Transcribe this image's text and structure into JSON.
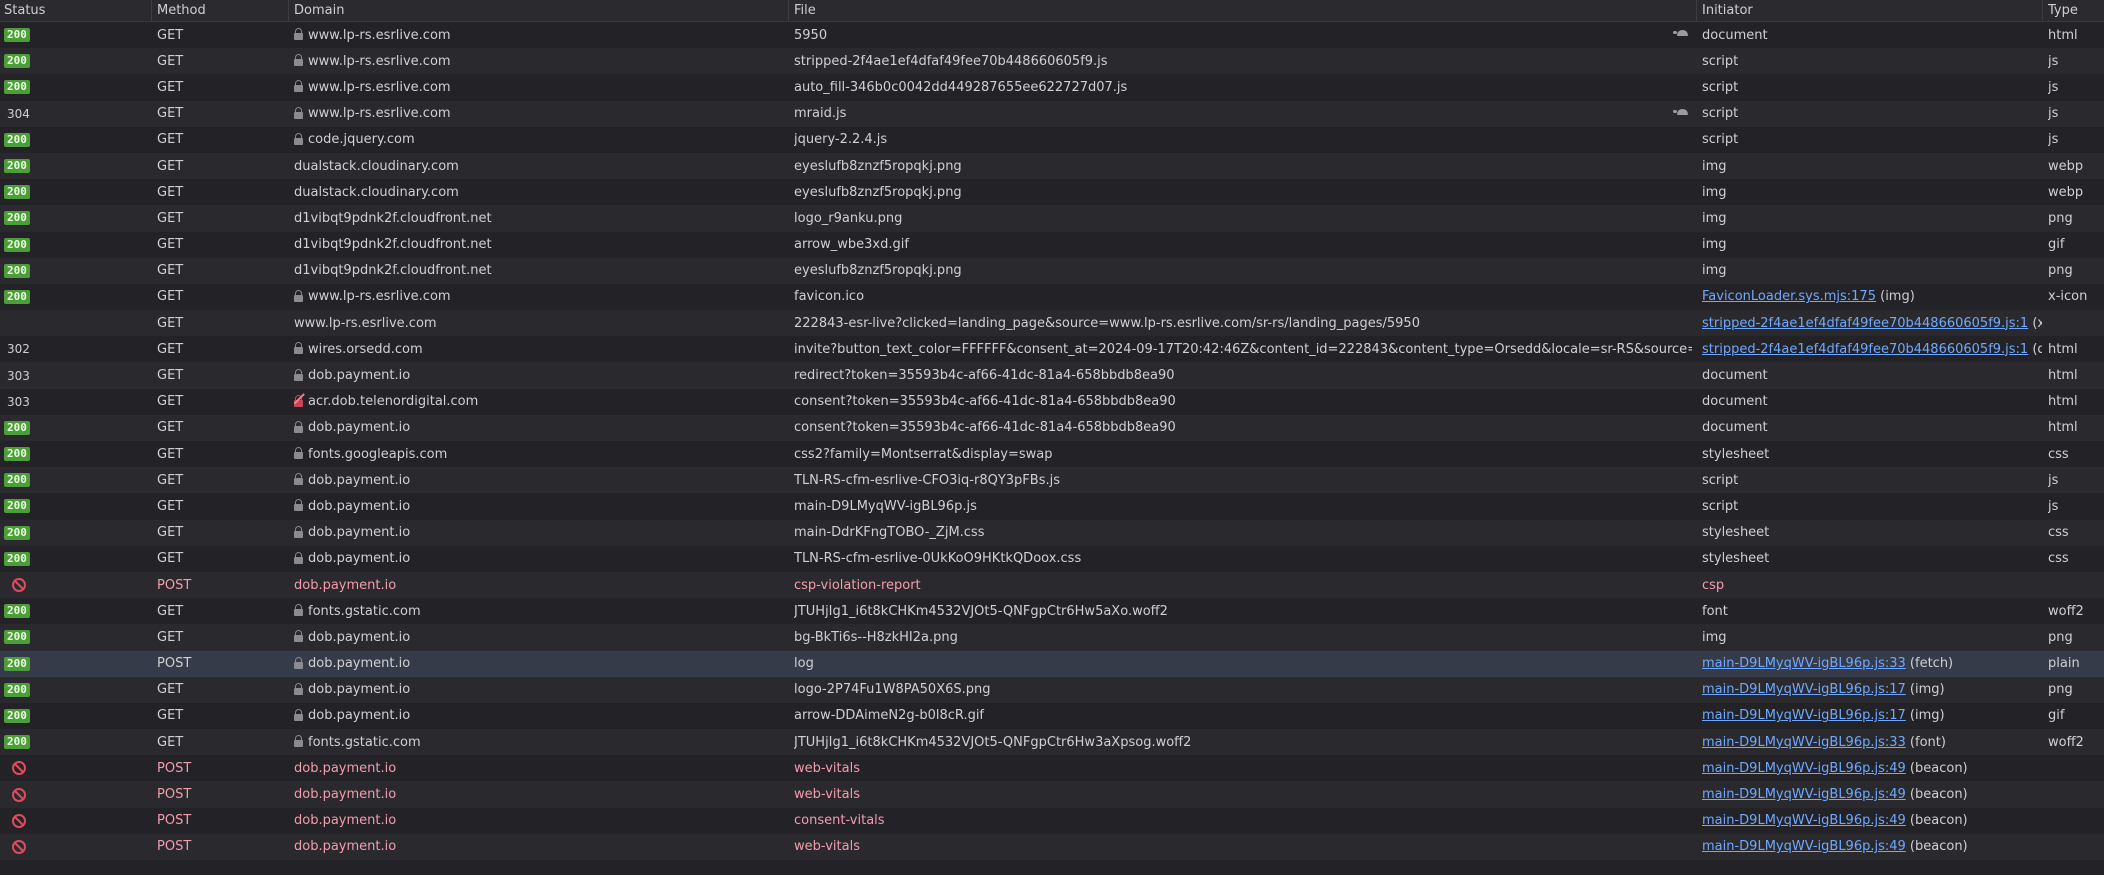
{
  "headers": {
    "status": "Status",
    "method": "Method",
    "domain": "Domain",
    "file": "File",
    "initiator": "Initiator",
    "type": "Type"
  },
  "rows": [
    {
      "status": "200",
      "method": "GET",
      "lock": "secure",
      "domain": "www.lp-rs.esrlive.com",
      "file": "5950",
      "initiator": "document",
      "initiator_link": false,
      "type": "html",
      "slow": true
    },
    {
      "status": "200",
      "method": "GET",
      "lock": "secure",
      "domain": "www.lp-rs.esrlive.com",
      "file": "stripped-2f4ae1ef4dfaf49fee70b448660605f9.js",
      "initiator": "script",
      "initiator_link": false,
      "type": "js"
    },
    {
      "status": "200",
      "method": "GET",
      "lock": "secure",
      "domain": "www.lp-rs.esrlive.com",
      "file": "auto_fill-346b0c0042dd449287655ee622727d07.js",
      "initiator": "script",
      "initiator_link": false,
      "type": "js"
    },
    {
      "status": "304",
      "method": "GET",
      "lock": "secure",
      "domain": "www.lp-rs.esrlive.com",
      "file": "mraid.js",
      "initiator": "script",
      "initiator_link": false,
      "type": "js",
      "slow": true
    },
    {
      "status": "200",
      "method": "GET",
      "lock": "secure",
      "domain": "code.jquery.com",
      "file": "jquery-2.2.4.js",
      "initiator": "script",
      "initiator_link": false,
      "type": "js"
    },
    {
      "status": "200",
      "method": "GET",
      "lock": "none",
      "domain": "dualstack.cloudinary.com",
      "file": "eyeslufb8znzf5ropqkj.png",
      "initiator": "img",
      "initiator_link": false,
      "type": "webp"
    },
    {
      "status": "200",
      "method": "GET",
      "lock": "none",
      "domain": "dualstack.cloudinary.com",
      "file": "eyeslufb8znzf5ropqkj.png",
      "initiator": "img",
      "initiator_link": false,
      "type": "webp"
    },
    {
      "status": "200",
      "method": "GET",
      "lock": "none",
      "domain": "d1vibqt9pdnk2f.cloudfront.net",
      "file": "logo_r9anku.png",
      "initiator": "img",
      "initiator_link": false,
      "type": "png"
    },
    {
      "status": "200",
      "method": "GET",
      "lock": "none",
      "domain": "d1vibqt9pdnk2f.cloudfront.net",
      "file": "arrow_wbe3xd.gif",
      "initiator": "img",
      "initiator_link": false,
      "type": "gif"
    },
    {
      "status": "200",
      "method": "GET",
      "lock": "none",
      "domain": "d1vibqt9pdnk2f.cloudfront.net",
      "file": "eyeslufb8znzf5ropqkj.png",
      "initiator": "img",
      "initiator_link": false,
      "type": "png"
    },
    {
      "status": "200",
      "method": "GET",
      "lock": "secure",
      "domain": "www.lp-rs.esrlive.com",
      "file": "favicon.ico",
      "initiator": "FaviconLoader.sys.mjs:175",
      "initiator_suffix": " (img)",
      "initiator_link": true,
      "type": "x-icon"
    },
    {
      "status": "",
      "method": "GET",
      "lock": "none",
      "domain": "www.lp-rs.esrlive.com",
      "file": "222843-esr-live?clicked=landing_page&source=www.lp-rs.esrlive.com/sr-rs/landing_pages/5950",
      "initiator": "stripped-2f4ae1ef4dfaf49fee70b448660605f9.js:1",
      "initiator_suffix": " (xhr)",
      "initiator_link": true,
      "type": ""
    },
    {
      "status": "302",
      "method": "GET",
      "lock": "secure",
      "domain": "wires.orsedd.com",
      "file": "invite?button_text_color=FFFFFF&consent_at=2024-09-17T20:42:46Z&content_id=222843&content_type=Orsedd&locale=sr-RS&source=www.lp-rs.esrlive.com/sr-rs",
      "initiator": "stripped-2f4ae1ef4dfaf49fee70b448660605f9.js:1",
      "initiator_suffix": " (docum...",
      "initiator_link": true,
      "type": "html"
    },
    {
      "status": "303",
      "method": "GET",
      "lock": "secure",
      "domain": "dob.payment.io",
      "file": "redirect?token=35593b4c-af66-41dc-81a4-658bbdb8ea90",
      "initiator": "document",
      "initiator_link": false,
      "type": "html"
    },
    {
      "status": "303",
      "method": "GET",
      "lock": "warn",
      "domain": "acr.dob.telenordigital.com",
      "file": "consent?token=35593b4c-af66-41dc-81a4-658bbdb8ea90",
      "initiator": "document",
      "initiator_link": false,
      "type": "html"
    },
    {
      "status": "200",
      "method": "GET",
      "lock": "secure",
      "domain": "dob.payment.io",
      "file": "consent?token=35593b4c-af66-41dc-81a4-658bbdb8ea90",
      "initiator": "document",
      "initiator_link": false,
      "type": "html"
    },
    {
      "status": "200",
      "method": "GET",
      "lock": "secure",
      "domain": "fonts.googleapis.com",
      "file": "css2?family=Montserrat&display=swap",
      "initiator": "stylesheet",
      "initiator_link": false,
      "type": "css"
    },
    {
      "status": "200",
      "method": "GET",
      "lock": "secure",
      "domain": "dob.payment.io",
      "file": "TLN-RS-cfm-esrlive-CFO3iq-r8QY3pFBs.js",
      "initiator": "script",
      "initiator_link": false,
      "type": "js"
    },
    {
      "status": "200",
      "method": "GET",
      "lock": "secure",
      "domain": "dob.payment.io",
      "file": "main-D9LMyqWV-igBL96p.js",
      "initiator": "script",
      "initiator_link": false,
      "type": "js"
    },
    {
      "status": "200",
      "method": "GET",
      "lock": "secure",
      "domain": "dob.payment.io",
      "file": "main-DdrKFngTOBO-_ZjM.css",
      "initiator": "stylesheet",
      "initiator_link": false,
      "type": "css"
    },
    {
      "status": "200",
      "method": "GET",
      "lock": "secure",
      "domain": "dob.payment.io",
      "file": "TLN-RS-cfm-esrlive-0UkKoO9HKtkQDoox.css",
      "initiator": "stylesheet",
      "initiator_link": false,
      "type": "css"
    },
    {
      "status": "blocked",
      "method": "POST",
      "lock": "none",
      "domain": "dob.payment.io",
      "file": "csp-violation-report",
      "initiator": "csp",
      "initiator_link": false,
      "type": ""
    },
    {
      "status": "200",
      "method": "GET",
      "lock": "secure",
      "domain": "fonts.gstatic.com",
      "file": "JTUHjIg1_i6t8kCHKm4532VJOt5-QNFgpCtr6Hw5aXo.woff2",
      "initiator": "font",
      "initiator_link": false,
      "type": "woff2"
    },
    {
      "status": "200",
      "method": "GET",
      "lock": "secure",
      "domain": "dob.payment.io",
      "file": "bg-BkTi6s--H8zkHI2a.png",
      "initiator": "img",
      "initiator_link": false,
      "type": "png"
    },
    {
      "status": "200",
      "method": "POST",
      "lock": "secure",
      "domain": "dob.payment.io",
      "file": "log",
      "initiator": "main-D9LMyqWV-igBL96p.js:33",
      "initiator_suffix": " (fetch)",
      "initiator_link": true,
      "type": "plain",
      "highlight": true
    },
    {
      "status": "200",
      "method": "GET",
      "lock": "secure",
      "domain": "dob.payment.io",
      "file": "logo-2P74Fu1W8PA50X6S.png",
      "initiator": "main-D9LMyqWV-igBL96p.js:17",
      "initiator_suffix": " (img)",
      "initiator_link": true,
      "type": "png"
    },
    {
      "status": "200",
      "method": "GET",
      "lock": "secure",
      "domain": "dob.payment.io",
      "file": "arrow-DDAimeN2g-b0l8cR.gif",
      "initiator": "main-D9LMyqWV-igBL96p.js:17",
      "initiator_suffix": " (img)",
      "initiator_link": true,
      "type": "gif"
    },
    {
      "status": "200",
      "method": "GET",
      "lock": "secure",
      "domain": "fonts.gstatic.com",
      "file": "JTUHjIg1_i6t8kCHKm4532VJOt5-QNFgpCtr6Hw3aXpsog.woff2",
      "initiator": "main-D9LMyqWV-igBL96p.js:33",
      "initiator_suffix": " (font)",
      "initiator_link": true,
      "type": "woff2"
    },
    {
      "status": "blocked",
      "method": "POST",
      "lock": "none",
      "domain": "dob.payment.io",
      "file": "web-vitals",
      "initiator": "main-D9LMyqWV-igBL96p.js:49",
      "initiator_suffix": " (beacon)",
      "initiator_link": true,
      "type": ""
    },
    {
      "status": "blocked",
      "method": "POST",
      "lock": "none",
      "domain": "dob.payment.io",
      "file": "web-vitals",
      "initiator": "main-D9LMyqWV-igBL96p.js:49",
      "initiator_suffix": " (beacon)",
      "initiator_link": true,
      "type": ""
    },
    {
      "status": "blocked",
      "method": "POST",
      "lock": "none",
      "domain": "dob.payment.io",
      "file": "consent-vitals",
      "initiator": "main-D9LMyqWV-igBL96p.js:49",
      "initiator_suffix": " (beacon)",
      "initiator_link": true,
      "type": ""
    },
    {
      "status": "blocked",
      "method": "POST",
      "lock": "none",
      "domain": "dob.payment.io",
      "file": "web-vitals",
      "initiator": "main-D9LMyqWV-igBL96p.js:49",
      "initiator_suffix": " (beacon)",
      "initiator_link": true,
      "type": ""
    }
  ],
  "colors": {
    "ok_badge": "#4d9e3a",
    "blocked": "#e04a5f",
    "link": "#6fa8ff",
    "highlight_row": "#353b48"
  }
}
